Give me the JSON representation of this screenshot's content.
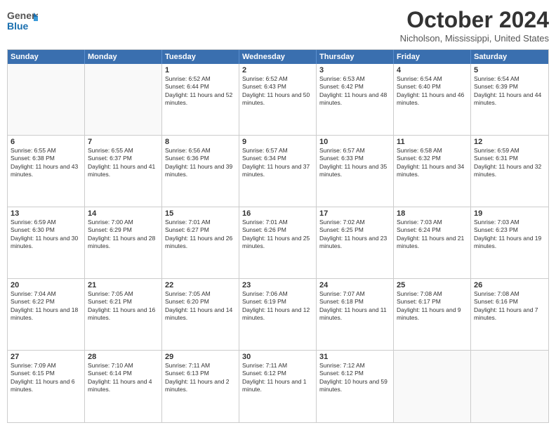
{
  "header": {
    "logo": {
      "line1": "General",
      "line2": "Blue"
    },
    "title": "October 2024",
    "location": "Nicholson, Mississippi, United States"
  },
  "days_of_week": [
    "Sunday",
    "Monday",
    "Tuesday",
    "Wednesday",
    "Thursday",
    "Friday",
    "Saturday"
  ],
  "weeks": [
    [
      {
        "num": "",
        "empty": true
      },
      {
        "num": "",
        "empty": true
      },
      {
        "num": "1",
        "sunrise": "6:52 AM",
        "sunset": "6:44 PM",
        "daylight": "11 hours and 52 minutes."
      },
      {
        "num": "2",
        "sunrise": "6:52 AM",
        "sunset": "6:43 PM",
        "daylight": "11 hours and 50 minutes."
      },
      {
        "num": "3",
        "sunrise": "6:53 AM",
        "sunset": "6:42 PM",
        "daylight": "11 hours and 48 minutes."
      },
      {
        "num": "4",
        "sunrise": "6:54 AM",
        "sunset": "6:40 PM",
        "daylight": "11 hours and 46 minutes."
      },
      {
        "num": "5",
        "sunrise": "6:54 AM",
        "sunset": "6:39 PM",
        "daylight": "11 hours and 44 minutes."
      }
    ],
    [
      {
        "num": "6",
        "sunrise": "6:55 AM",
        "sunset": "6:38 PM",
        "daylight": "11 hours and 43 minutes."
      },
      {
        "num": "7",
        "sunrise": "6:55 AM",
        "sunset": "6:37 PM",
        "daylight": "11 hours and 41 minutes."
      },
      {
        "num": "8",
        "sunrise": "6:56 AM",
        "sunset": "6:36 PM",
        "daylight": "11 hours and 39 minutes."
      },
      {
        "num": "9",
        "sunrise": "6:57 AM",
        "sunset": "6:34 PM",
        "daylight": "11 hours and 37 minutes."
      },
      {
        "num": "10",
        "sunrise": "6:57 AM",
        "sunset": "6:33 PM",
        "daylight": "11 hours and 35 minutes."
      },
      {
        "num": "11",
        "sunrise": "6:58 AM",
        "sunset": "6:32 PM",
        "daylight": "11 hours and 34 minutes."
      },
      {
        "num": "12",
        "sunrise": "6:59 AM",
        "sunset": "6:31 PM",
        "daylight": "11 hours and 32 minutes."
      }
    ],
    [
      {
        "num": "13",
        "sunrise": "6:59 AM",
        "sunset": "6:30 PM",
        "daylight": "11 hours and 30 minutes."
      },
      {
        "num": "14",
        "sunrise": "7:00 AM",
        "sunset": "6:29 PM",
        "daylight": "11 hours and 28 minutes."
      },
      {
        "num": "15",
        "sunrise": "7:01 AM",
        "sunset": "6:27 PM",
        "daylight": "11 hours and 26 minutes."
      },
      {
        "num": "16",
        "sunrise": "7:01 AM",
        "sunset": "6:26 PM",
        "daylight": "11 hours and 25 minutes."
      },
      {
        "num": "17",
        "sunrise": "7:02 AM",
        "sunset": "6:25 PM",
        "daylight": "11 hours and 23 minutes."
      },
      {
        "num": "18",
        "sunrise": "7:03 AM",
        "sunset": "6:24 PM",
        "daylight": "11 hours and 21 minutes."
      },
      {
        "num": "19",
        "sunrise": "7:03 AM",
        "sunset": "6:23 PM",
        "daylight": "11 hours and 19 minutes."
      }
    ],
    [
      {
        "num": "20",
        "sunrise": "7:04 AM",
        "sunset": "6:22 PM",
        "daylight": "11 hours and 18 minutes."
      },
      {
        "num": "21",
        "sunrise": "7:05 AM",
        "sunset": "6:21 PM",
        "daylight": "11 hours and 16 minutes."
      },
      {
        "num": "22",
        "sunrise": "7:05 AM",
        "sunset": "6:20 PM",
        "daylight": "11 hours and 14 minutes."
      },
      {
        "num": "23",
        "sunrise": "7:06 AM",
        "sunset": "6:19 PM",
        "daylight": "11 hours and 12 minutes."
      },
      {
        "num": "24",
        "sunrise": "7:07 AM",
        "sunset": "6:18 PM",
        "daylight": "11 hours and 11 minutes."
      },
      {
        "num": "25",
        "sunrise": "7:08 AM",
        "sunset": "6:17 PM",
        "daylight": "11 hours and 9 minutes."
      },
      {
        "num": "26",
        "sunrise": "7:08 AM",
        "sunset": "6:16 PM",
        "daylight": "11 hours and 7 minutes."
      }
    ],
    [
      {
        "num": "27",
        "sunrise": "7:09 AM",
        "sunset": "6:15 PM",
        "daylight": "11 hours and 6 minutes."
      },
      {
        "num": "28",
        "sunrise": "7:10 AM",
        "sunset": "6:14 PM",
        "daylight": "11 hours and 4 minutes."
      },
      {
        "num": "29",
        "sunrise": "7:11 AM",
        "sunset": "6:13 PM",
        "daylight": "11 hours and 2 minutes."
      },
      {
        "num": "30",
        "sunrise": "7:11 AM",
        "sunset": "6:12 PM",
        "daylight": "11 hours and 1 minute."
      },
      {
        "num": "31",
        "sunrise": "7:12 AM",
        "sunset": "6:12 PM",
        "daylight": "10 hours and 59 minutes."
      },
      {
        "num": "",
        "empty": true
      },
      {
        "num": "",
        "empty": true
      }
    ]
  ]
}
